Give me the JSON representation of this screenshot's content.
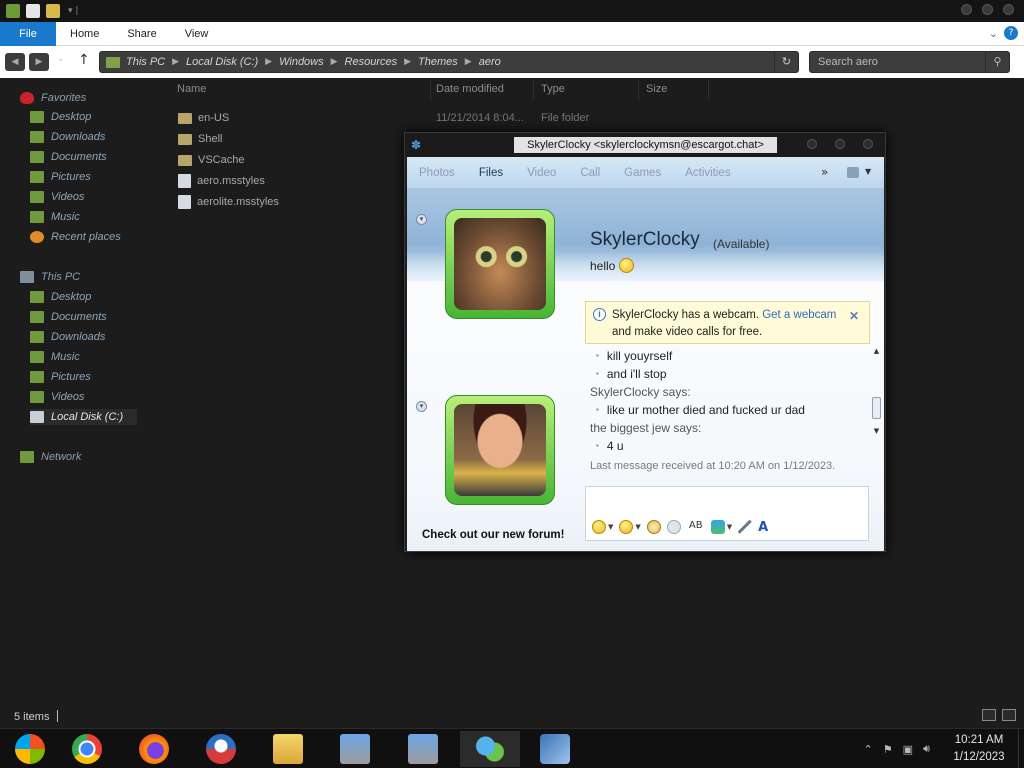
{
  "ribbon": {
    "tabs": [
      "File",
      "Home",
      "Share",
      "View"
    ]
  },
  "address": {
    "path": [
      "This PC",
      "Local Disk (C:)",
      "Windows",
      "Resources",
      "Themes",
      "aero"
    ],
    "search_placeholder": "Search aero"
  },
  "nav": {
    "favorites_label": "Favorites",
    "favorites": [
      "Desktop",
      "Downloads",
      "Documents",
      "Pictures",
      "Videos",
      "Music",
      "Recent places"
    ],
    "thispc_label": "This PC",
    "thispc": [
      "Desktop",
      "Documents",
      "Downloads",
      "Music",
      "Pictures",
      "Videos",
      "Local Disk (C:)"
    ],
    "network_label": "Network"
  },
  "columns": {
    "name": "Name",
    "date": "Date modified",
    "type": "Type",
    "size": "Size"
  },
  "files": [
    {
      "name": "en-US",
      "kind": "folder"
    },
    {
      "name": "Shell",
      "kind": "folder"
    },
    {
      "name": "VSCache",
      "kind": "folder"
    },
    {
      "name": "aero.msstyles",
      "kind": "file"
    },
    {
      "name": "aerolite.msstyles",
      "kind": "file"
    }
  ],
  "first_row_meta": {
    "date": "11/21/2014 8:04...",
    "type": "File folder"
  },
  "status": {
    "items": "5 items"
  },
  "messenger": {
    "title": "SkylerClocky <skylerclockymsn@escargot.chat>",
    "toolbar": [
      "Photos",
      "Files",
      "Video",
      "Call",
      "Games",
      "Activities"
    ],
    "toolbar_more": "»",
    "contact_name": "SkylerClocky",
    "contact_status": "(Available)",
    "personal_message": "hello",
    "notice": {
      "text1": "SkylerClocky has a webcam.",
      "link": "Get a webcam",
      "text2": "and make video calls for free."
    },
    "conversation": [
      {
        "kind": "msg",
        "text": "kill youyrself"
      },
      {
        "kind": "msg",
        "text": "and i'll stop"
      },
      {
        "kind": "speaker",
        "text": "SkylerClocky says:"
      },
      {
        "kind": "msg",
        "text": "like ur mother died and fucked ur dad"
      },
      {
        "kind": "speaker",
        "text": "the biggest jew says:"
      },
      {
        "kind": "msg",
        "text": "4 u"
      }
    ],
    "last_received": "Last message received at 10:20 AM on 1/12/2023.",
    "footer_ad": "Check out our new forum!"
  },
  "taskbar": {
    "time": "10:21 AM",
    "date": "1/12/2023"
  }
}
